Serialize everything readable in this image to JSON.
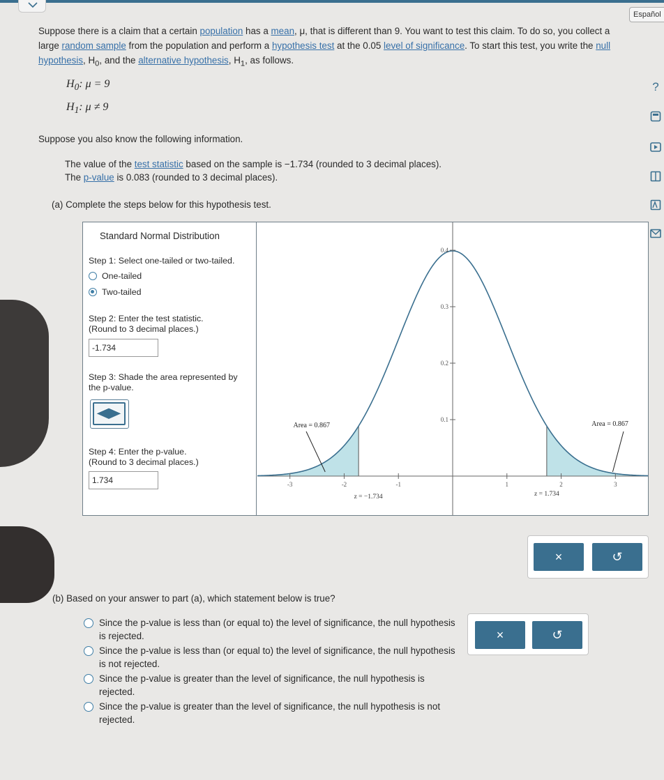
{
  "language_button": "Español",
  "intro": {
    "t1": "Suppose there is a claim that a certain ",
    "l_population": "population",
    "t2": " has a ",
    "l_mean": "mean",
    "t3": ", μ, that is different than 9. You want to test this claim. To do so, you collect a large ",
    "l_random_sample": "random sample",
    "t4": " from the population and perform a ",
    "l_hypothesis_test": "hypothesis test",
    "t5": " at the 0.05 ",
    "l_level": "level of significance",
    "t6": ". To start this test, you write the ",
    "l_null": "null hypothesis",
    "t7": ", H",
    "t7sub": "0",
    "t8": ", and the ",
    "l_alt": "alternative hypothesis",
    "t9": ", H",
    "t9sub": "1",
    "t10": ", as follows."
  },
  "hypotheses": {
    "h0_lhs": "H",
    "h0_sub": "0",
    "h0_rhs": ": μ = 9",
    "h1_lhs": "H",
    "h1_sub": "1",
    "h1_rhs": ": μ ≠ 9"
  },
  "know": "Suppose you also know the following information.",
  "info": {
    "stat_pre": "The value of the ",
    "stat_link": "test statistic",
    "stat_post": " based on the sample is −1.734 (rounded to 3 decimal places).",
    "p_pre": "The ",
    "p_link": "p-value",
    "p_post": " is 0.083 (rounded to 3 decimal places)."
  },
  "part_a": "(a) Complete the steps below for this hypothesis test.",
  "panel": {
    "title": "Standard Normal Distribution",
    "step1": "Step 1: Select one-tailed or two-tailed.",
    "opt_one": "One-tailed",
    "opt_two": "Two-tailed",
    "selected_tail": "two",
    "step2_l1": "Step 2: Enter the test statistic.",
    "step2_l2": "(Round to 3 decimal places.)",
    "step2_value": "-1.734",
    "step3_l1": "Step 3: Shade the area represented by",
    "step3_l2": "the p-value.",
    "step4_l1": "Step 4: Enter the p-value.",
    "step4_l2": "(Round to 3 decimal places.)",
    "step4_value": "1.734"
  },
  "chart_data": {
    "type": "area",
    "curve": "standard normal density",
    "x_ticks": [
      "-3",
      "-2",
      "-1",
      "1",
      "2",
      "3"
    ],
    "y_ticks": [
      "0.1",
      "0.2",
      "0.3",
      "0.4"
    ],
    "xlim": [
      -3.6,
      3.6
    ],
    "ylim": [
      0,
      0.4
    ],
    "shaded_left": [
      -3.6,
      -1.734
    ],
    "shaded_right": [
      1.734,
      3.6
    ],
    "left_label": "Area = 0.867",
    "right_label": "Area = 0.867",
    "left_z": "z = −1.734",
    "right_z": "z = 1.734"
  },
  "part_b": "(b) Based on your answer to part (a), which statement below is true?",
  "options_b": [
    "Since the p-value is less than (or equal to) the level of significance, the null hypothesis is rejected.",
    "Since the p-value is less than (or equal to) the level of significance, the null hypothesis is not rejected.",
    "Since the p-value is greater than the level of significance, the null hypothesis is rejected.",
    "Since the p-value is greater than the level of significance, the null hypothesis is not rejected."
  ],
  "buttons": {
    "clear": "×",
    "undo": "↺"
  },
  "colors": {
    "accent": "#3a6f8f",
    "shade": "#a9d8e0",
    "link": "#3770a8"
  }
}
